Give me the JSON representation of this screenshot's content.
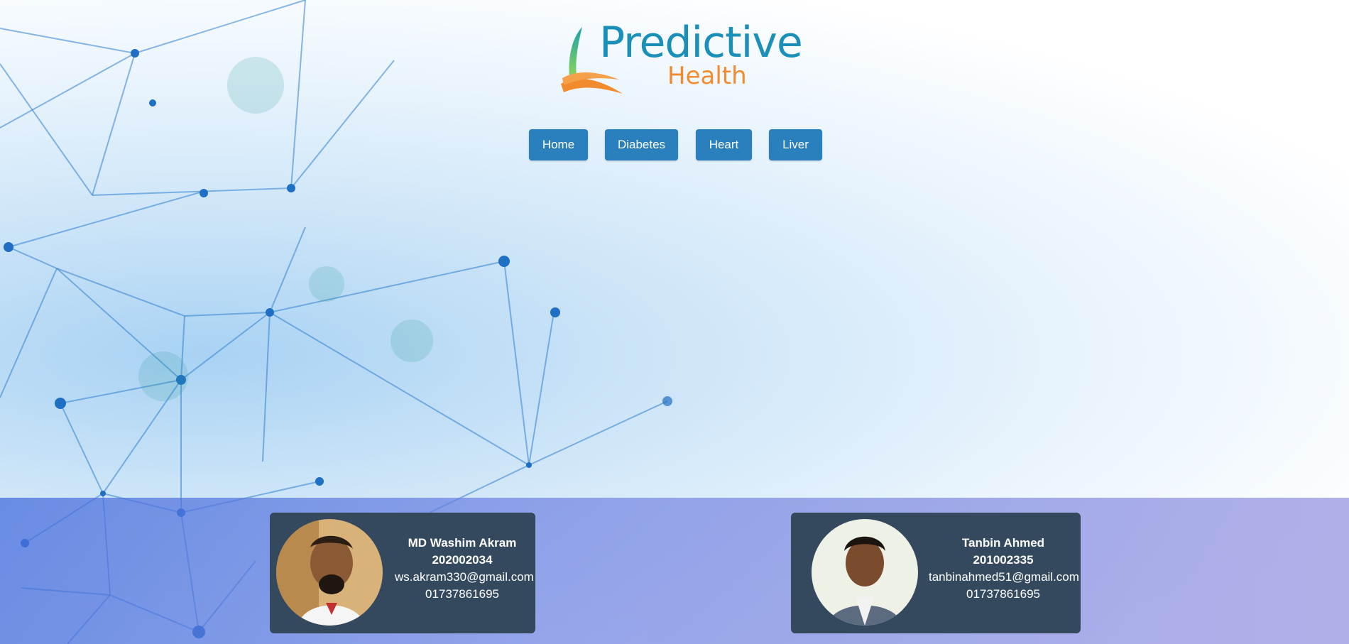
{
  "logo": {
    "line1": "Predictive",
    "line2": "Health"
  },
  "nav": {
    "items": [
      {
        "label": "Home"
      },
      {
        "label": "Diabetes"
      },
      {
        "label": "Heart"
      },
      {
        "label": "Liver"
      }
    ]
  },
  "footer": {
    "members": [
      {
        "name": "MD Washim Akram",
        "id": "202002034",
        "email": "ws.akram330@gmail.com",
        "phone": "01737861695"
      },
      {
        "name": "Tanbin Ahmed",
        "id": "201002335",
        "email": "tanbinahmed51@gmail.com",
        "phone": "01737861695"
      }
    ]
  },
  "colors": {
    "brand_teal": "#1a8fb8",
    "brand_orange": "#f28a2e",
    "nav_button": "#2a7fbd",
    "card_bg": "#34495e"
  }
}
